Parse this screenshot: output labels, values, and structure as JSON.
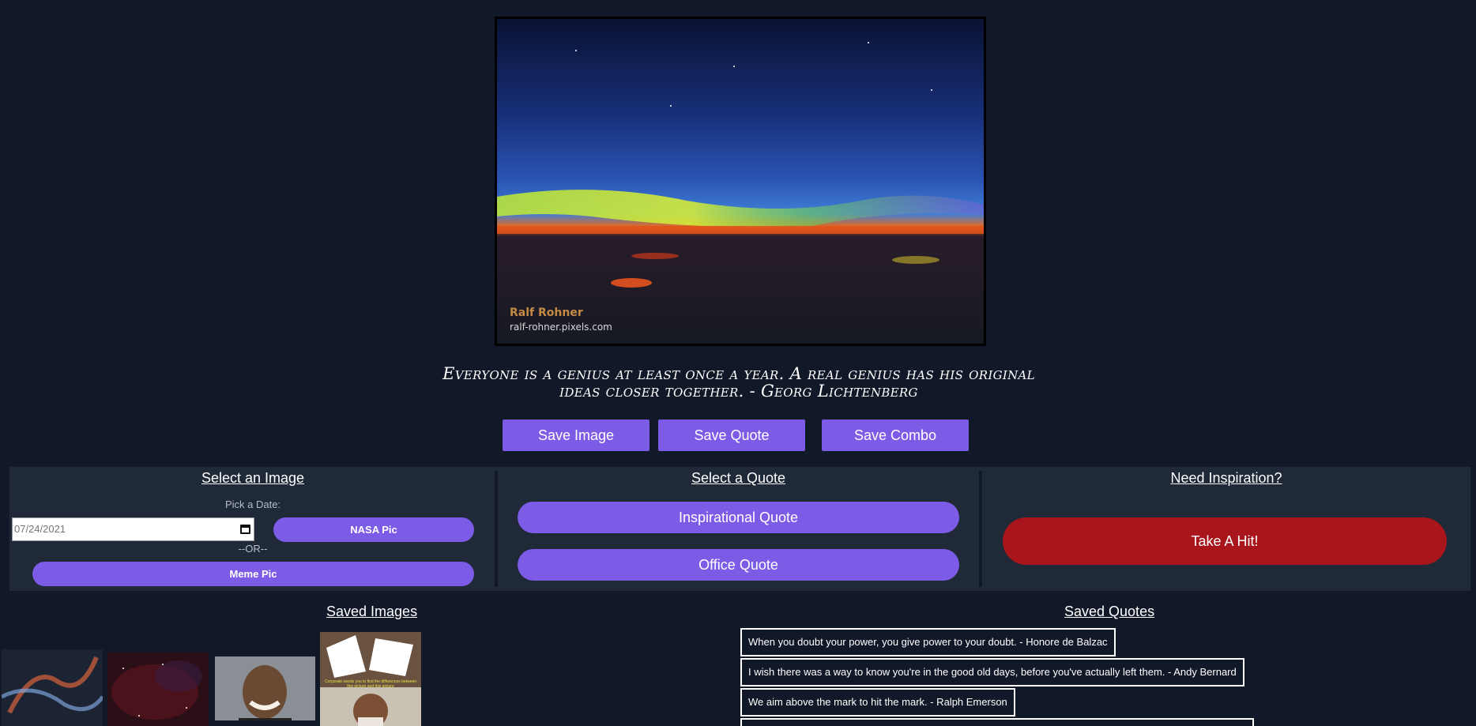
{
  "hero": {
    "watermark_name": "Ralf Rohner",
    "watermark_site": "ralf-rohner.pixels.com"
  },
  "quote": {
    "text": "Everyone is a genius at least once a year. A real genius has his original ideas closer together. - Georg Lichtenberg"
  },
  "save_buttons": {
    "image": "Save Image",
    "quote": "Save Quote",
    "combo": "Save Combo"
  },
  "image_panel": {
    "title": "Select an Image",
    "date_label": "Pick a Date:",
    "date_value": "07/24/2021",
    "nasa_button": "NASA Pic",
    "or_label": "--OR--",
    "meme_button": "Meme Pic"
  },
  "quote_panel": {
    "title": "Select a Quote",
    "inspirational_button": "Inspirational Quote",
    "office_button": "Office Quote"
  },
  "inspiration_panel": {
    "title": "Need Inspiration?",
    "hit_button": "Take A Hit!"
  },
  "saved_images": {
    "title": "Saved Images",
    "meme_caption": "Corporate needs you to find the differences between this picture and this picture"
  },
  "saved_quotes": {
    "title": "Saved Quotes",
    "items": [
      "When you doubt your power, you give power to your doubt. - Honore de Balzac",
      "I wish there was a way to know you're in the good old days, before you've actually left them. - Andy Bernard",
      "We aim above the mark to hit the mark. - Ralph Emerson"
    ]
  },
  "colors": {
    "background": "#111827",
    "panel": "#1f2937",
    "accent": "#7c5ce6",
    "danger": "#a8161c"
  }
}
